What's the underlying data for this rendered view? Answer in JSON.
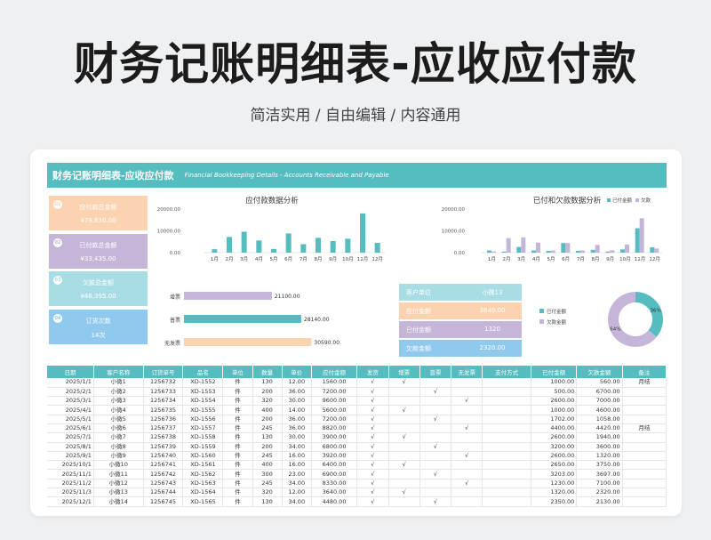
{
  "hero": {
    "title": "财务记账明细表-应收应付款",
    "subtitle": "简洁实用 / 自由编辑 / 内容通用"
  },
  "banner": {
    "title": "财务记账明细表-应收应付款",
    "subtitle_en": "Financial Bookkeeping Details - Accounts Receivable and Payable"
  },
  "cards": [
    {
      "num": "01",
      "label": "应付款总金额",
      "value": "¥79,830.00",
      "color": "#fbd3b0"
    },
    {
      "num": "02",
      "label": "已付款总金额",
      "value": "¥33,435.00",
      "color": "#c5b6d9"
    },
    {
      "num": "03",
      "label": "欠款总金额",
      "value": "¥46,395.00",
      "color": "#a9dde5"
    },
    {
      "num": "04",
      "label": "订货次数",
      "value": "14次",
      "color": "#8fc9ee"
    }
  ],
  "colors": {
    "teal": "#55bcc0",
    "purple": "#c5b6d9",
    "peach": "#fbd3b0",
    "blue": "#8fc9ee"
  },
  "chart_data": [
    {
      "type": "bar",
      "title": "应付款数据分析",
      "categories": [
        "1月",
        "2月",
        "3月",
        "4月",
        "5月",
        "6月",
        "7月",
        "8月",
        "9月",
        "10月",
        "11月",
        "12月"
      ],
      "values": [
        1560,
        7200,
        9600,
        5600,
        1700,
        8820,
        3900,
        6800,
        5300,
        6400,
        18000,
        4480
      ],
      "ylim": [
        0,
        20000
      ],
      "yticks": [
        "20000.00",
        "10000.00",
        "0.00"
      ]
    },
    {
      "type": "bar",
      "title": "已付和欠款数据分析",
      "categories": [
        "1月",
        "2月",
        "3月",
        "4月",
        "5月",
        "6月",
        "7月",
        "8月",
        "9月",
        "10月",
        "11月",
        "12月"
      ],
      "series": [
        {
          "name": "已付金额",
          "values": [
            1000,
            500,
            2600,
            1000,
            800,
            4400,
            800,
            1300,
            500,
            1500,
            11200,
            2500
          ],
          "color": "#55bcc0"
        },
        {
          "name": "欠款",
          "values": [
            560,
            6700,
            7000,
            4600,
            1000,
            4420,
            1000,
            3600,
            1100,
            3750,
            15800,
            1900
          ],
          "color": "#c5b6d9"
        }
      ],
      "ylim": [
        0,
        20000
      ],
      "yticks": [
        "20000.00",
        "10000.00",
        "0.00"
      ],
      "legend": "top-right"
    },
    {
      "type": "bar",
      "orientation": "horizontal",
      "categories": [
        "增票",
        "普票",
        "无发票"
      ],
      "values": [
        21100,
        28140,
        30590
      ],
      "labels": [
        "21100.00",
        "28140.00",
        "30590.00"
      ],
      "colors": [
        "#c5b6d9",
        "#55bcc0",
        "#fbd3b0"
      ]
    },
    {
      "type": "pie",
      "donut": true,
      "slices": [
        {
          "name": "已付金额",
          "value": 36,
          "label": "36%",
          "color": "#55bcc0"
        },
        {
          "name": "欠款金额",
          "value": 64,
          "label": "64%",
          "color": "#c5b6d9"
        }
      ],
      "legend": "left"
    }
  ],
  "customer_panel": {
    "rows": [
      {
        "label": "客户单位",
        "value": "小微13",
        "color": "#a9dde5"
      },
      {
        "label": "应付金额",
        "value": "3640.00",
        "color": "#fbd3b0"
      },
      {
        "label": "已付金额",
        "value": "1320",
        "color": "#c5b6d9"
      },
      {
        "label": "欠款金额",
        "value": "2320.00",
        "color": "#8fc9ee"
      }
    ]
  },
  "table": {
    "headers": [
      "日期",
      "客户名称",
      "订货单号",
      "品名",
      "单位",
      "数量",
      "单价",
      "应付金额",
      "发货",
      "增票",
      "普票",
      "无发票",
      "支付方式",
      "已付金额",
      "欠款金额",
      "备注"
    ],
    "rows": [
      [
        "2025/1/1",
        "小微1",
        "1256732",
        "XD-1552",
        "件",
        "130",
        "12.00",
        "1560.00",
        "√",
        "√",
        "",
        "",
        "",
        "1000.00",
        "560.00",
        "月结"
      ],
      [
        "2025/2/1",
        "小微2",
        "1256733",
        "XD-1553",
        "件",
        "200",
        "36.00",
        "7200.00",
        "√",
        "",
        "√",
        "",
        "",
        "500.00",
        "6700.00",
        ""
      ],
      [
        "2025/3/1",
        "小微3",
        "1256734",
        "XD-1554",
        "件",
        "320",
        "30.00",
        "9600.00",
        "√",
        "",
        "",
        "√",
        "",
        "2600.00",
        "7000.00",
        ""
      ],
      [
        "2025/4/1",
        "小微4",
        "1256735",
        "XD-1555",
        "件",
        "400",
        "14.00",
        "5600.00",
        "√",
        "√",
        "",
        "",
        "",
        "1000.00",
        "4600.00",
        ""
      ],
      [
        "2025/5/1",
        "小微5",
        "1256736",
        "XD-1556",
        "件",
        "200",
        "36.00",
        "7200.00",
        "√",
        "",
        "√",
        "",
        "",
        "1702.00",
        "1058.00",
        ""
      ],
      [
        "2025/6/1",
        "小微6",
        "1256737",
        "XD-1557",
        "件",
        "245",
        "36.00",
        "8820.00",
        "√",
        "",
        "",
        "√",
        "",
        "4400.00",
        "4420.00",
        "月结"
      ],
      [
        "2025/7/1",
        "小微7",
        "1256738",
        "XD-1558",
        "件",
        "130",
        "30.00",
        "3900.00",
        "√",
        "√",
        "",
        "",
        "",
        "2600.00",
        "1940.00",
        ""
      ],
      [
        "2025/8/1",
        "小微8",
        "1256739",
        "XD-1559",
        "件",
        "200",
        "34.00",
        "6800.00",
        "√",
        "",
        "√",
        "",
        "",
        "3200.00",
        "3600.00",
        ""
      ],
      [
        "2025/9/1",
        "小微9",
        "1256740",
        "XD-1560",
        "件",
        "245",
        "16.00",
        "3920.00",
        "√",
        "",
        "",
        "√",
        "",
        "2600.00",
        "1320.00",
        ""
      ],
      [
        "2025/10/1",
        "小微10",
        "1256741",
        "XD-1561",
        "件",
        "400",
        "16.00",
        "6400.00",
        "√",
        "√",
        "",
        "",
        "",
        "2650.00",
        "3750.00",
        ""
      ],
      [
        "2025/11/1",
        "小微11",
        "1256742",
        "XD-1562",
        "件",
        "300",
        "23.00",
        "6900.00",
        "√",
        "",
        "√",
        "",
        "",
        "3203.00",
        "3697.00",
        ""
      ],
      [
        "2025/11/2",
        "小微12",
        "1256743",
        "XD-1563",
        "件",
        "245",
        "34.00",
        "8330.00",
        "√",
        "",
        "",
        "√",
        "",
        "1230.00",
        "7100.00",
        ""
      ],
      [
        "2025/11/3",
        "小微13",
        "1256744",
        "XD-1564",
        "件",
        "320",
        "12.00",
        "3640.00",
        "√",
        "√",
        "",
        "",
        "",
        "1320.00",
        "2320.00",
        ""
      ],
      [
        "2025/12/1",
        "小微14",
        "1256745",
        "XD-1565",
        "件",
        "130",
        "34.00",
        "4480.00",
        "√",
        "",
        "√",
        "",
        "",
        "2350.00",
        "2130.00",
        ""
      ]
    ]
  }
}
